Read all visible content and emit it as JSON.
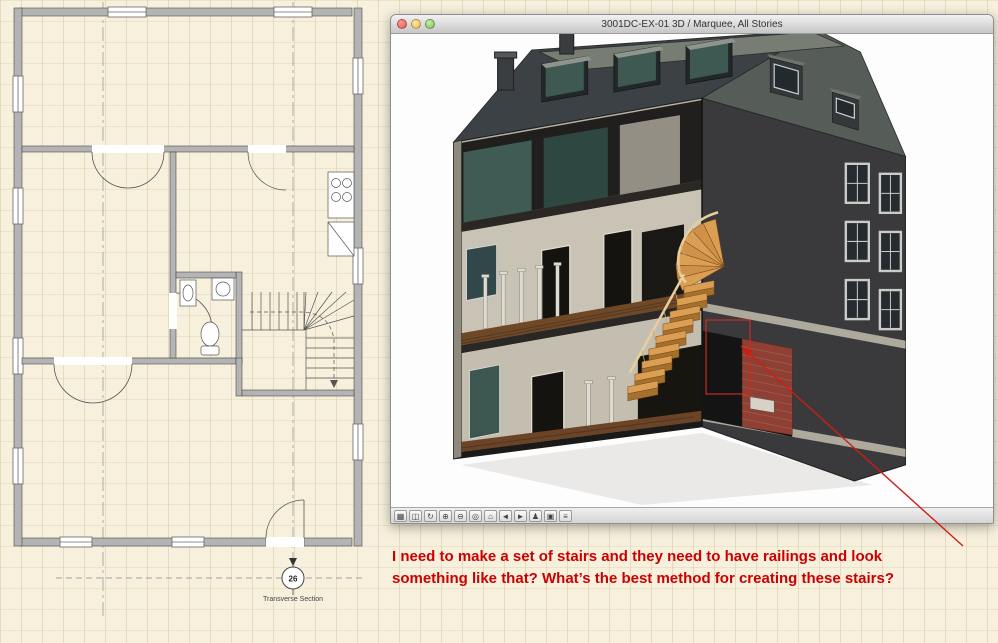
{
  "window": {
    "title": "3001DC-EX-01 3D / Marquee, All Stories",
    "toolbar_icons": [
      {
        "name": "axonometry-icon",
        "glyph": "▦"
      },
      {
        "name": "marquee-icon",
        "glyph": "◫"
      },
      {
        "name": "orbit-icon",
        "glyph": "↻"
      },
      {
        "name": "zoom-in-icon",
        "glyph": "⊕"
      },
      {
        "name": "zoom-out-icon",
        "glyph": "⊖"
      },
      {
        "name": "fit-in-window-icon",
        "glyph": "◎"
      },
      {
        "name": "home-view-icon",
        "glyph": "⌂"
      },
      {
        "name": "previous-view-icon",
        "glyph": "◄"
      },
      {
        "name": "next-view-icon",
        "glyph": "►"
      },
      {
        "name": "explore-icon",
        "glyph": "♟"
      },
      {
        "name": "camera-icon",
        "glyph": "▣"
      },
      {
        "name": "view-settings-icon",
        "glyph": "≡"
      }
    ]
  },
  "floor_plan": {
    "section_marker_number": "26",
    "section_marker_label": "Transverse Section"
  },
  "annotation": {
    "line1": "I need to make a set of stairs and they need to have railings and look",
    "line2": "something like that? What’s the best method for creating these stairs?"
  },
  "colors": {
    "canvas_background": "#f7f0dd",
    "annotation_red": "#cc0000",
    "arrow_red": "#cc1f14",
    "stair_wood": "#db9f53",
    "brick": "#8e4034",
    "roof_dark": "#3c4145"
  }
}
